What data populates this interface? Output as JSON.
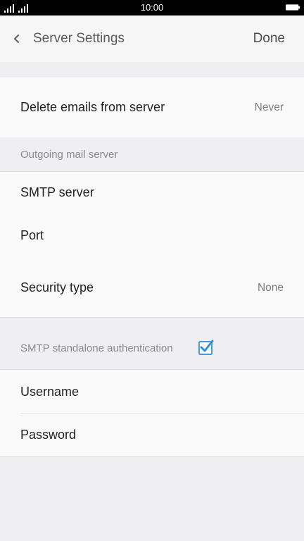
{
  "status_bar": {
    "time": "10:00"
  },
  "header": {
    "title": "Server Settings",
    "done_label": "Done"
  },
  "delete_emails": {
    "label": "Delete emails from server",
    "value": "Never"
  },
  "outgoing": {
    "header": "Outgoing mail server",
    "smtp_server_label": "SMTP server",
    "port_label": "Port",
    "security_type_label": "Security type",
    "security_type_value": "None"
  },
  "auth": {
    "header": "SMTP standalone authentication",
    "checked": true,
    "username_label": "Username",
    "password_label": "Password"
  },
  "colors": {
    "accent": "#2f8fd8",
    "background": "#efeff1",
    "row_background": "#fafafa"
  }
}
